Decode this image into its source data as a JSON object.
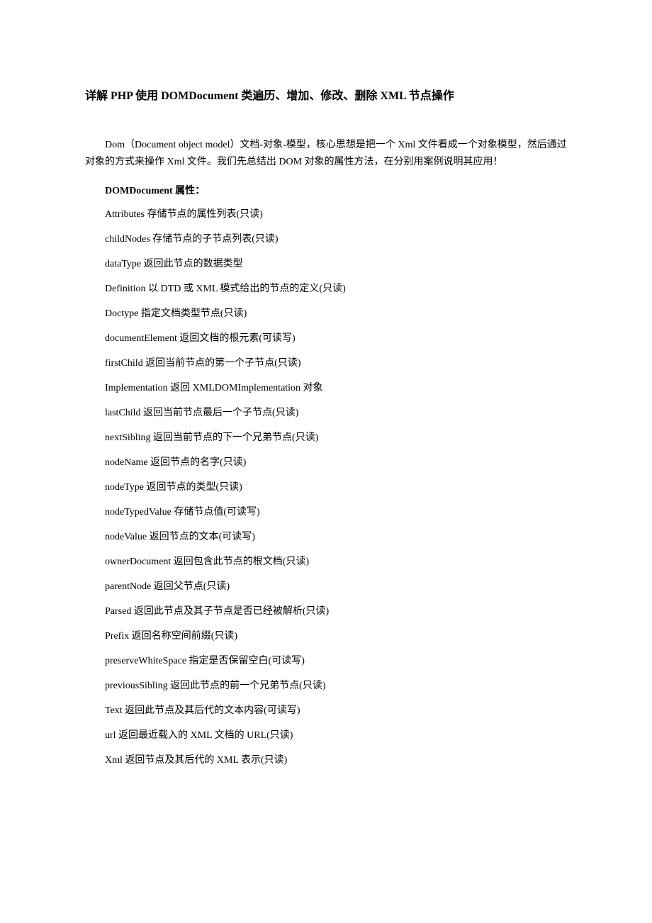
{
  "title": "详解 PHP 使用 DOMDocument 类遍历、增加、修改、删除 XML 节点操作",
  "intro": "Dom（Document object model）文档-对象-模型，核心思想是把一个 Xml 文件看成一个对象模型，然后通过对象的方式来操作 Xml 文件。我们先总结出 DOM 对象的属性方法，在分别用案例说明其应用！",
  "section_heading": "DOMDocument  属性：",
  "properties": [
    "Attributes  存储节点的属性列表(只读)",
    "childNodes  存储节点的子节点列表(只读)",
    "dataType  返回此节点的数据类型",
    "Definition  以 DTD 或 XML 模式给出的节点的定义(只读)",
    "Doctype  指定文档类型节点(只读)",
    "documentElement  返回文档的根元素(可读写)",
    "firstChild  返回当前节点的第一个子节点(只读)",
    "Implementation  返回 XMLDOMImplementation 对象",
    "lastChild  返回当前节点最后一个子节点(只读)",
    "nextSibling  返回当前节点的下一个兄弟节点(只读)",
    "nodeName  返回节点的名字(只读)",
    "nodeType  返回节点的类型(只读)",
    "nodeTypedValue  存储节点值(可读写)",
    "nodeValue  返回节点的文本(可读写)",
    "ownerDocument  返回包含此节点的根文档(只读)",
    "parentNode  返回父节点(只读)",
    "Parsed  返回此节点及其子节点是否已经被解析(只读)",
    "Prefix  返回名称空间前缀(只读)",
    "preserveWhiteSpace  指定是否保留空白(可读写)",
    "previousSibling  返回此节点的前一个兄弟节点(只读)",
    "Text  返回此节点及其后代的文本内容(可读写)",
    "url  返回最近载入的 XML 文档的 URL(只读)",
    "Xml  返回节点及其后代的 XML 表示(只读)"
  ]
}
